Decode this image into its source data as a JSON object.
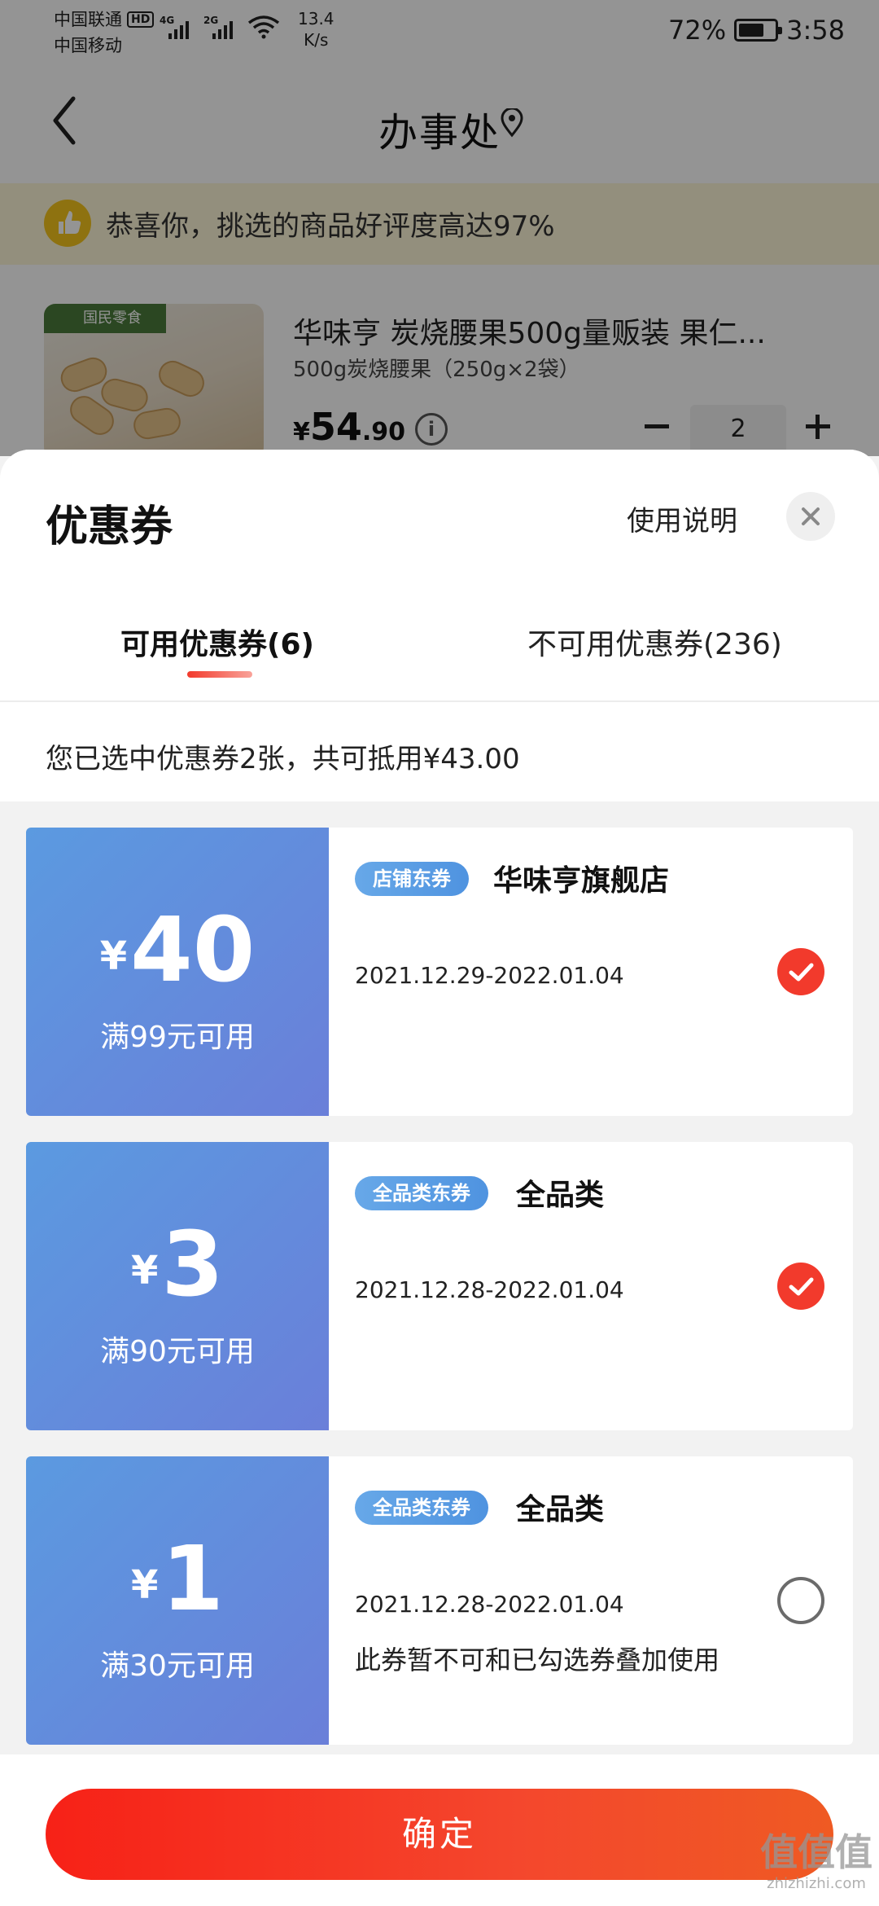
{
  "status_bar": {
    "carrier1": "中国联通",
    "hd_badge": "HD",
    "carrier2": "中国移动",
    "net1": "4G",
    "net2": "2G",
    "speed_value": "13.4",
    "speed_unit": "K/s",
    "battery_percent": "72%",
    "battery_level": 0.72,
    "time": "3:58"
  },
  "nav": {
    "title": "办事处",
    "back_icon": "chevron-left-icon",
    "location_icon": "location-pin-icon"
  },
  "notice": {
    "icon": "thumbs-up-icon",
    "text": "恭喜你，挑选的商品好评度高达97%"
  },
  "product": {
    "image_banner": "国民零食",
    "name": "华味亨 炭烧腰果500g量贩装  果仁...",
    "spec": "500g炭烧腰果（250g×2袋）",
    "price_symbol": "¥",
    "price_int": "54",
    "price_dec": ".90",
    "quantity": "2"
  },
  "sheet": {
    "title": "优惠券",
    "usage_link": "使用说明",
    "tabs": [
      {
        "label": "可用优惠券(6)",
        "active": true
      },
      {
        "label": "不可用优惠券(236)",
        "active": false
      }
    ],
    "summary": "您已选中优惠券2张，共可抵用¥43.00",
    "coupons": [
      {
        "currency": "¥",
        "amount": "40",
        "threshold": "满99元可用",
        "tag": "店铺东券",
        "shop": "华味亨旗舰店",
        "date": "2021.12.29-2022.01.04",
        "note": "",
        "selected": true
      },
      {
        "currency": "¥",
        "amount": "3",
        "threshold": "满90元可用",
        "tag": "全品类东券",
        "shop": "全品类",
        "date": "2021.12.28-2022.01.04",
        "note": "",
        "selected": true
      },
      {
        "currency": "¥",
        "amount": "1",
        "threshold": "满30元可用",
        "tag": "全品类东券",
        "shop": "全品类",
        "date": "2021.12.28-2022.01.04",
        "note": "此券暂不可和已勾选券叠加使用",
        "selected": false
      }
    ],
    "confirm_label": "确定"
  },
  "watermark": {
    "logo": "值值值",
    "url": "zhizhizhi.com"
  },
  "colors": {
    "accent_red": "#f23a2c",
    "coupon_blue": "#5b9ae0",
    "notice_bg": "#fdf6d8"
  }
}
